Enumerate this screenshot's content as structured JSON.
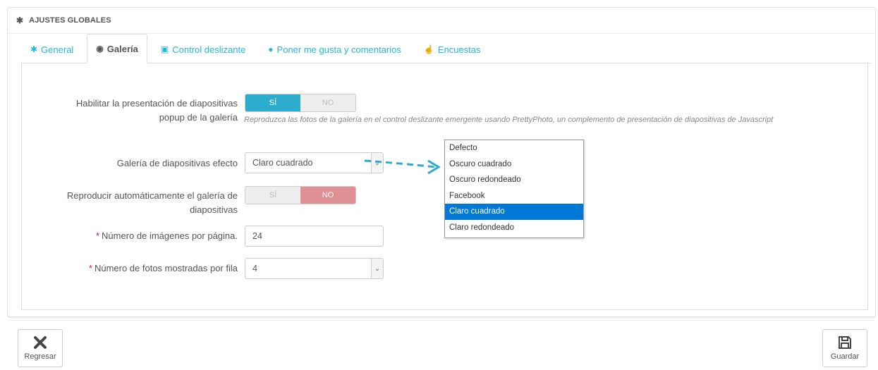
{
  "panel": {
    "title": "AJUSTES GLOBALES",
    "icon": "gear-icon"
  },
  "tabs": [
    {
      "label": "General",
      "icon": "gear-icon"
    },
    {
      "label": "Galería",
      "icon": "dashboard-icon"
    },
    {
      "label": "Control deslizante",
      "icon": "image-icon"
    },
    {
      "label": "Poner me gusta y comentarios",
      "icon": "comments-icon"
    },
    {
      "label": "Encuestas",
      "icon": "thumbs-up-icon"
    }
  ],
  "form": {
    "popup": {
      "label_line1": "Habilitar la presentación de diapositivas",
      "label_line2": "popup de la galería",
      "yes": "SÍ",
      "no": "NO",
      "value": "yes",
      "help": "Reproduzca las fotos de la galería en el control deslizante emergente usando PrettyPhoto, un complemento de presentación de diapositivas de Javascript"
    },
    "effect": {
      "label": "Galería de diapositivas efecto",
      "value": "Claro cuadrado"
    },
    "autoplay": {
      "label_line1": "Reproducir automáticamente el galería de",
      "label_line2": "diapositivas",
      "yes": "SÍ",
      "no": "NO",
      "value": "no"
    },
    "per_page": {
      "label": "Número de imágenes por página.",
      "required": "*",
      "value": "24"
    },
    "per_row": {
      "label": "Número de fotos mostradas por fila",
      "required": "*",
      "value": "4"
    }
  },
  "dropdown": {
    "options": [
      "Defecto",
      "Oscuro cuadrado",
      "Oscuro redondeado",
      "Facebook",
      "Claro cuadrado",
      "Claro redondeado"
    ],
    "selected": "Claro cuadrado"
  },
  "footer": {
    "back_label": "Regresar",
    "save_label": "Guardar"
  },
  "colors": {
    "accent": "#25b9d7",
    "toggle_on": "#2eacce",
    "toggle_off": "#e08f95",
    "selected_option": "#0078d7",
    "arrow": "#2eacce"
  }
}
